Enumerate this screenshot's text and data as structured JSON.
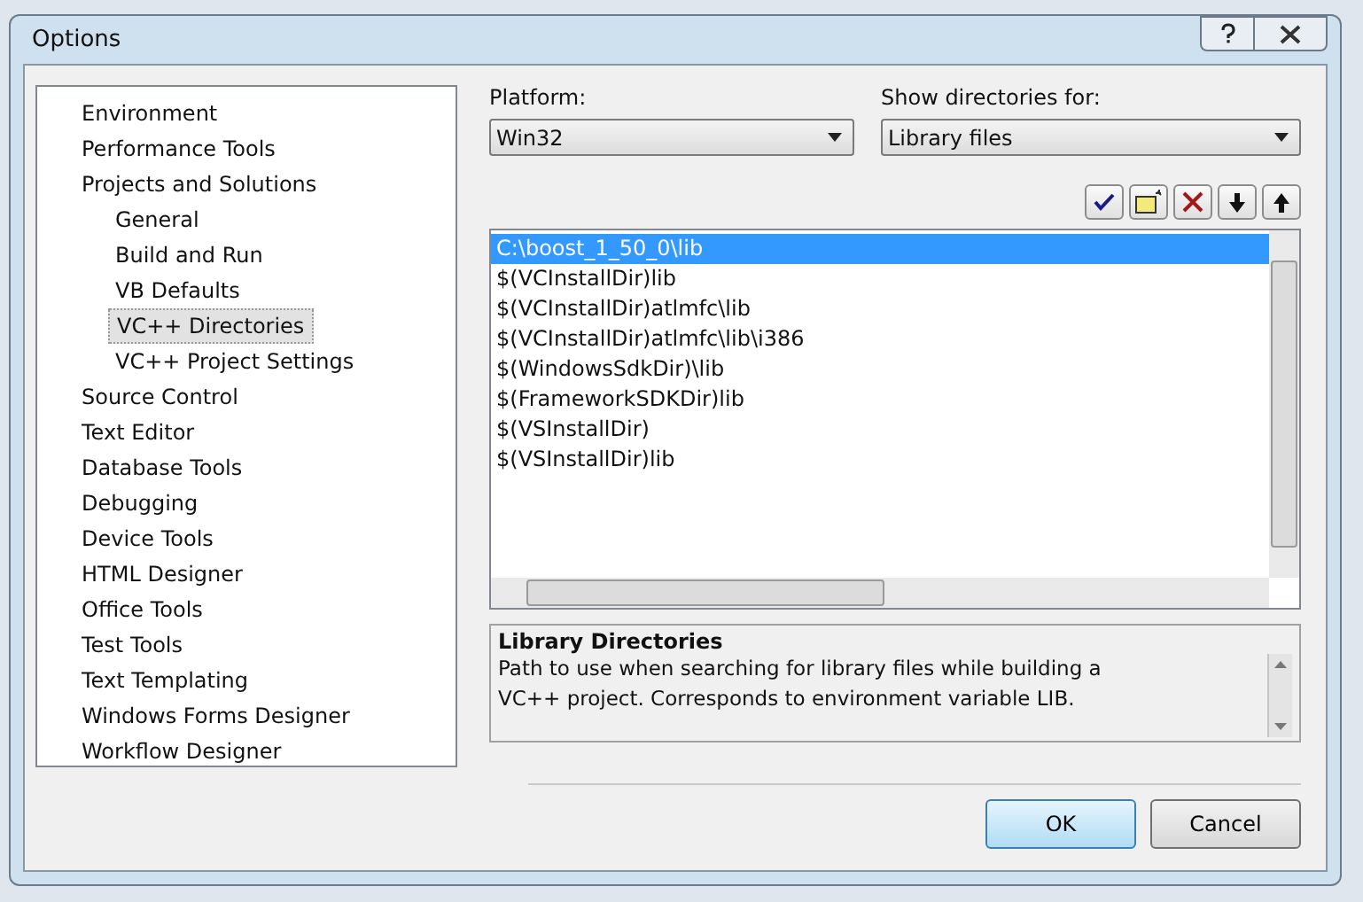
{
  "window": {
    "title": "Options"
  },
  "tree": [
    {
      "label": "Environment",
      "selected": false
    },
    {
      "label": "Performance Tools",
      "selected": false
    },
    {
      "label": "Projects and Solutions",
      "selected": false,
      "children": [
        {
          "label": "General",
          "selected": false
        },
        {
          "label": "Build and Run",
          "selected": false
        },
        {
          "label": "VB Defaults",
          "selected": false
        },
        {
          "label": "VC++ Directories",
          "selected": true
        },
        {
          "label": "VC++ Project Settings",
          "selected": false
        }
      ]
    },
    {
      "label": "Source Control",
      "selected": false
    },
    {
      "label": "Text Editor",
      "selected": false
    },
    {
      "label": "Database Tools",
      "selected": false
    },
    {
      "label": "Debugging",
      "selected": false
    },
    {
      "label": "Device Tools",
      "selected": false
    },
    {
      "label": "HTML Designer",
      "selected": false
    },
    {
      "label": "Office Tools",
      "selected": false
    },
    {
      "label": "Test Tools",
      "selected": false
    },
    {
      "label": "Text Templating",
      "selected": false
    },
    {
      "label": "Windows Forms Designer",
      "selected": false
    },
    {
      "label": "Workflow Designer",
      "selected": false
    }
  ],
  "platform": {
    "label": "Platform:",
    "value": "Win32"
  },
  "show_directories": {
    "label": "Show directories for:",
    "value": "Library files"
  },
  "directories": [
    {
      "text": "C:\\boost_1_50_0\\lib",
      "selected": true
    },
    {
      "text": "$(VCInstallDir)lib",
      "selected": false
    },
    {
      "text": "$(VCInstallDir)atlmfc\\lib",
      "selected": false
    },
    {
      "text": "$(VCInstallDir)atlmfc\\lib\\i386",
      "selected": false
    },
    {
      "text": "$(WindowsSdkDir)\\lib",
      "selected": false
    },
    {
      "text": "$(FrameworkSDKDir)lib",
      "selected": false
    },
    {
      "text": "$(VSInstallDir)",
      "selected": false
    },
    {
      "text": "$(VSInstallDir)lib",
      "selected": false
    }
  ],
  "description": {
    "title": "Library Directories",
    "text": "Path to use when searching for library files while building a VC++ project.  Corresponds to environment variable LIB."
  },
  "buttons": [
    "OK",
    "Cancel"
  ]
}
